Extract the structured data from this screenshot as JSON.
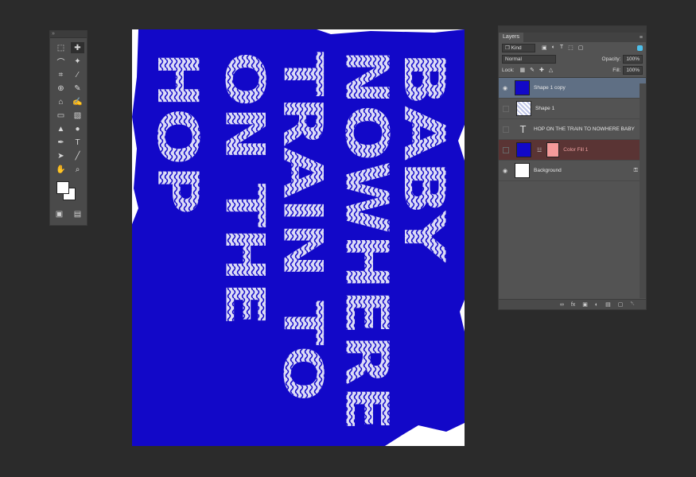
{
  "tools": {
    "header": "»",
    "items": [
      {
        "name": "marquee-tool-icon",
        "glyph": "⬚"
      },
      {
        "name": "move-tool-icon",
        "glyph": "✚",
        "active": true
      },
      {
        "name": "lasso-tool-icon",
        "glyph": "⌒"
      },
      {
        "name": "magic-wand-tool-icon",
        "glyph": "✦"
      },
      {
        "name": "crop-tool-icon",
        "glyph": "⌗"
      },
      {
        "name": "eyedropper-tool-icon",
        "glyph": "∕"
      },
      {
        "name": "healing-brush-tool-icon",
        "glyph": "⊕"
      },
      {
        "name": "brush-tool-icon",
        "glyph": "✎"
      },
      {
        "name": "clone-stamp-tool-icon",
        "glyph": "⌂"
      },
      {
        "name": "history-brush-tool-icon",
        "glyph": "✍"
      },
      {
        "name": "eraser-tool-icon",
        "glyph": "▭"
      },
      {
        "name": "gradient-tool-icon",
        "glyph": "▧"
      },
      {
        "name": "blur-tool-icon",
        "glyph": "▲"
      },
      {
        "name": "dodge-tool-icon",
        "glyph": "●"
      },
      {
        "name": "pen-tool-icon",
        "glyph": "✒"
      },
      {
        "name": "type-tool-icon",
        "glyph": "T"
      },
      {
        "name": "path-selection-tool-icon",
        "glyph": "➤"
      },
      {
        "name": "line-tool-icon",
        "glyph": "╱"
      },
      {
        "name": "hand-tool-icon",
        "glyph": "✋"
      },
      {
        "name": "zoom-tool-icon",
        "glyph": "⌕"
      }
    ],
    "bottom": [
      "▣",
      "▤"
    ]
  },
  "canvas": {
    "fill_color": "#1208c8",
    "text_color": "#dcdcf6",
    "columns": [
      "HOP",
      "ON THE",
      "TRAIN TO",
      "NOWHERE",
      "BABY"
    ]
  },
  "layers_panel": {
    "tab_label": "Layers",
    "menu_glyph": "≡",
    "filter_kind": "❐ Kind",
    "filter_icons": [
      "▣",
      "◐",
      "T",
      "⬚",
      "▢"
    ],
    "blend_mode": "Normal",
    "opacity_label": "Opacity:",
    "opacity_value": "100%",
    "lock_label": "Lock:",
    "lock_icons": [
      "▦",
      "✎",
      "✚",
      "△"
    ],
    "fill_label": "Fill:",
    "fill_value": "100%",
    "layers": [
      {
        "name": "Shape 1 copy",
        "visible": true,
        "thumb": "t-blue",
        "selected": true
      },
      {
        "name": "Shape 1",
        "visible": false,
        "thumb": "t-pattern"
      },
      {
        "name": "HOP ON THE TRAIN TO NOWHERE BABY",
        "visible": false,
        "thumb": "t-T"
      },
      {
        "name": "Color Fill 1",
        "visible": false,
        "thumb": "t-blue",
        "fill": true
      },
      {
        "name": "Background",
        "visible": true,
        "thumb": "t-white",
        "locked": true
      }
    ],
    "footer_icons": [
      "∞",
      "fx",
      "▣",
      "◐",
      "▤",
      "▢",
      "␡"
    ],
    "eye_glyph": "◉",
    "lock_glyph": "⚿"
  }
}
